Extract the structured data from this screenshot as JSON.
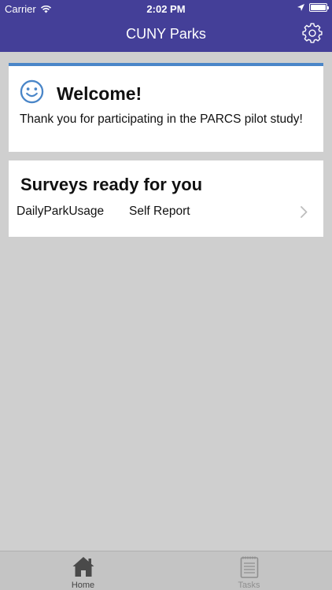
{
  "status_bar": {
    "carrier": "Carrier",
    "time": "2:02 PM"
  },
  "nav": {
    "title": "CUNY Parks"
  },
  "welcome": {
    "title": "Welcome!",
    "message": "Thank you for participating in the PARCS pilot study!"
  },
  "surveys": {
    "title": "Surveys ready for you",
    "items": [
      {
        "name": "DailyParkUsage",
        "type": "Self Report"
      }
    ]
  },
  "tabs": [
    {
      "label": "Home",
      "selected": true
    },
    {
      "label": "Tasks",
      "selected": false
    }
  ],
  "colors": {
    "header": "#443f98",
    "accent": "#4a86c8",
    "background": "#cfcfcf"
  },
  "icons": [
    "wifi-icon",
    "location-arrow-icon",
    "battery-icon",
    "gear-icon",
    "smiley-icon",
    "chevron-right-icon",
    "home-icon",
    "tasks-icon"
  ]
}
